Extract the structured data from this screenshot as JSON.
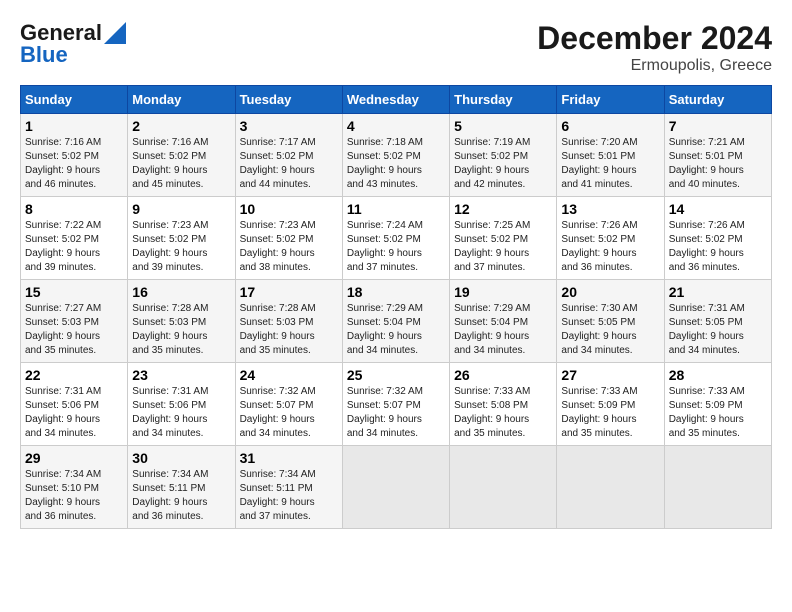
{
  "header": {
    "logo_line1": "General",
    "logo_line2": "Blue",
    "title": "December 2024",
    "subtitle": "Ermoupolis, Greece"
  },
  "days_of_week": [
    "Sunday",
    "Monday",
    "Tuesday",
    "Wednesday",
    "Thursday",
    "Friday",
    "Saturday"
  ],
  "weeks": [
    [
      {
        "day": 1,
        "info": "Sunrise: 7:16 AM\nSunset: 5:02 PM\nDaylight: 9 hours\nand 46 minutes."
      },
      {
        "day": 2,
        "info": "Sunrise: 7:16 AM\nSunset: 5:02 PM\nDaylight: 9 hours\nand 45 minutes."
      },
      {
        "day": 3,
        "info": "Sunrise: 7:17 AM\nSunset: 5:02 PM\nDaylight: 9 hours\nand 44 minutes."
      },
      {
        "day": 4,
        "info": "Sunrise: 7:18 AM\nSunset: 5:02 PM\nDaylight: 9 hours\nand 43 minutes."
      },
      {
        "day": 5,
        "info": "Sunrise: 7:19 AM\nSunset: 5:02 PM\nDaylight: 9 hours\nand 42 minutes."
      },
      {
        "day": 6,
        "info": "Sunrise: 7:20 AM\nSunset: 5:01 PM\nDaylight: 9 hours\nand 41 minutes."
      },
      {
        "day": 7,
        "info": "Sunrise: 7:21 AM\nSunset: 5:01 PM\nDaylight: 9 hours\nand 40 minutes."
      }
    ],
    [
      {
        "day": 8,
        "info": "Sunrise: 7:22 AM\nSunset: 5:02 PM\nDaylight: 9 hours\nand 39 minutes."
      },
      {
        "day": 9,
        "info": "Sunrise: 7:23 AM\nSunset: 5:02 PM\nDaylight: 9 hours\nand 39 minutes."
      },
      {
        "day": 10,
        "info": "Sunrise: 7:23 AM\nSunset: 5:02 PM\nDaylight: 9 hours\nand 38 minutes."
      },
      {
        "day": 11,
        "info": "Sunrise: 7:24 AM\nSunset: 5:02 PM\nDaylight: 9 hours\nand 37 minutes."
      },
      {
        "day": 12,
        "info": "Sunrise: 7:25 AM\nSunset: 5:02 PM\nDaylight: 9 hours\nand 37 minutes."
      },
      {
        "day": 13,
        "info": "Sunrise: 7:26 AM\nSunset: 5:02 PM\nDaylight: 9 hours\nand 36 minutes."
      },
      {
        "day": 14,
        "info": "Sunrise: 7:26 AM\nSunset: 5:02 PM\nDaylight: 9 hours\nand 36 minutes."
      }
    ],
    [
      {
        "day": 15,
        "info": "Sunrise: 7:27 AM\nSunset: 5:03 PM\nDaylight: 9 hours\nand 35 minutes."
      },
      {
        "day": 16,
        "info": "Sunrise: 7:28 AM\nSunset: 5:03 PM\nDaylight: 9 hours\nand 35 minutes."
      },
      {
        "day": 17,
        "info": "Sunrise: 7:28 AM\nSunset: 5:03 PM\nDaylight: 9 hours\nand 35 minutes."
      },
      {
        "day": 18,
        "info": "Sunrise: 7:29 AM\nSunset: 5:04 PM\nDaylight: 9 hours\nand 34 minutes."
      },
      {
        "day": 19,
        "info": "Sunrise: 7:29 AM\nSunset: 5:04 PM\nDaylight: 9 hours\nand 34 minutes."
      },
      {
        "day": 20,
        "info": "Sunrise: 7:30 AM\nSunset: 5:05 PM\nDaylight: 9 hours\nand 34 minutes."
      },
      {
        "day": 21,
        "info": "Sunrise: 7:31 AM\nSunset: 5:05 PM\nDaylight: 9 hours\nand 34 minutes."
      }
    ],
    [
      {
        "day": 22,
        "info": "Sunrise: 7:31 AM\nSunset: 5:06 PM\nDaylight: 9 hours\nand 34 minutes."
      },
      {
        "day": 23,
        "info": "Sunrise: 7:31 AM\nSunset: 5:06 PM\nDaylight: 9 hours\nand 34 minutes."
      },
      {
        "day": 24,
        "info": "Sunrise: 7:32 AM\nSunset: 5:07 PM\nDaylight: 9 hours\nand 34 minutes."
      },
      {
        "day": 25,
        "info": "Sunrise: 7:32 AM\nSunset: 5:07 PM\nDaylight: 9 hours\nand 34 minutes."
      },
      {
        "day": 26,
        "info": "Sunrise: 7:33 AM\nSunset: 5:08 PM\nDaylight: 9 hours\nand 35 minutes."
      },
      {
        "day": 27,
        "info": "Sunrise: 7:33 AM\nSunset: 5:09 PM\nDaylight: 9 hours\nand 35 minutes."
      },
      {
        "day": 28,
        "info": "Sunrise: 7:33 AM\nSunset: 5:09 PM\nDaylight: 9 hours\nand 35 minutes."
      }
    ],
    [
      {
        "day": 29,
        "info": "Sunrise: 7:34 AM\nSunset: 5:10 PM\nDaylight: 9 hours\nand 36 minutes."
      },
      {
        "day": 30,
        "info": "Sunrise: 7:34 AM\nSunset: 5:11 PM\nDaylight: 9 hours\nand 36 minutes."
      },
      {
        "day": 31,
        "info": "Sunrise: 7:34 AM\nSunset: 5:11 PM\nDaylight: 9 hours\nand 37 minutes."
      },
      null,
      null,
      null,
      null
    ]
  ]
}
